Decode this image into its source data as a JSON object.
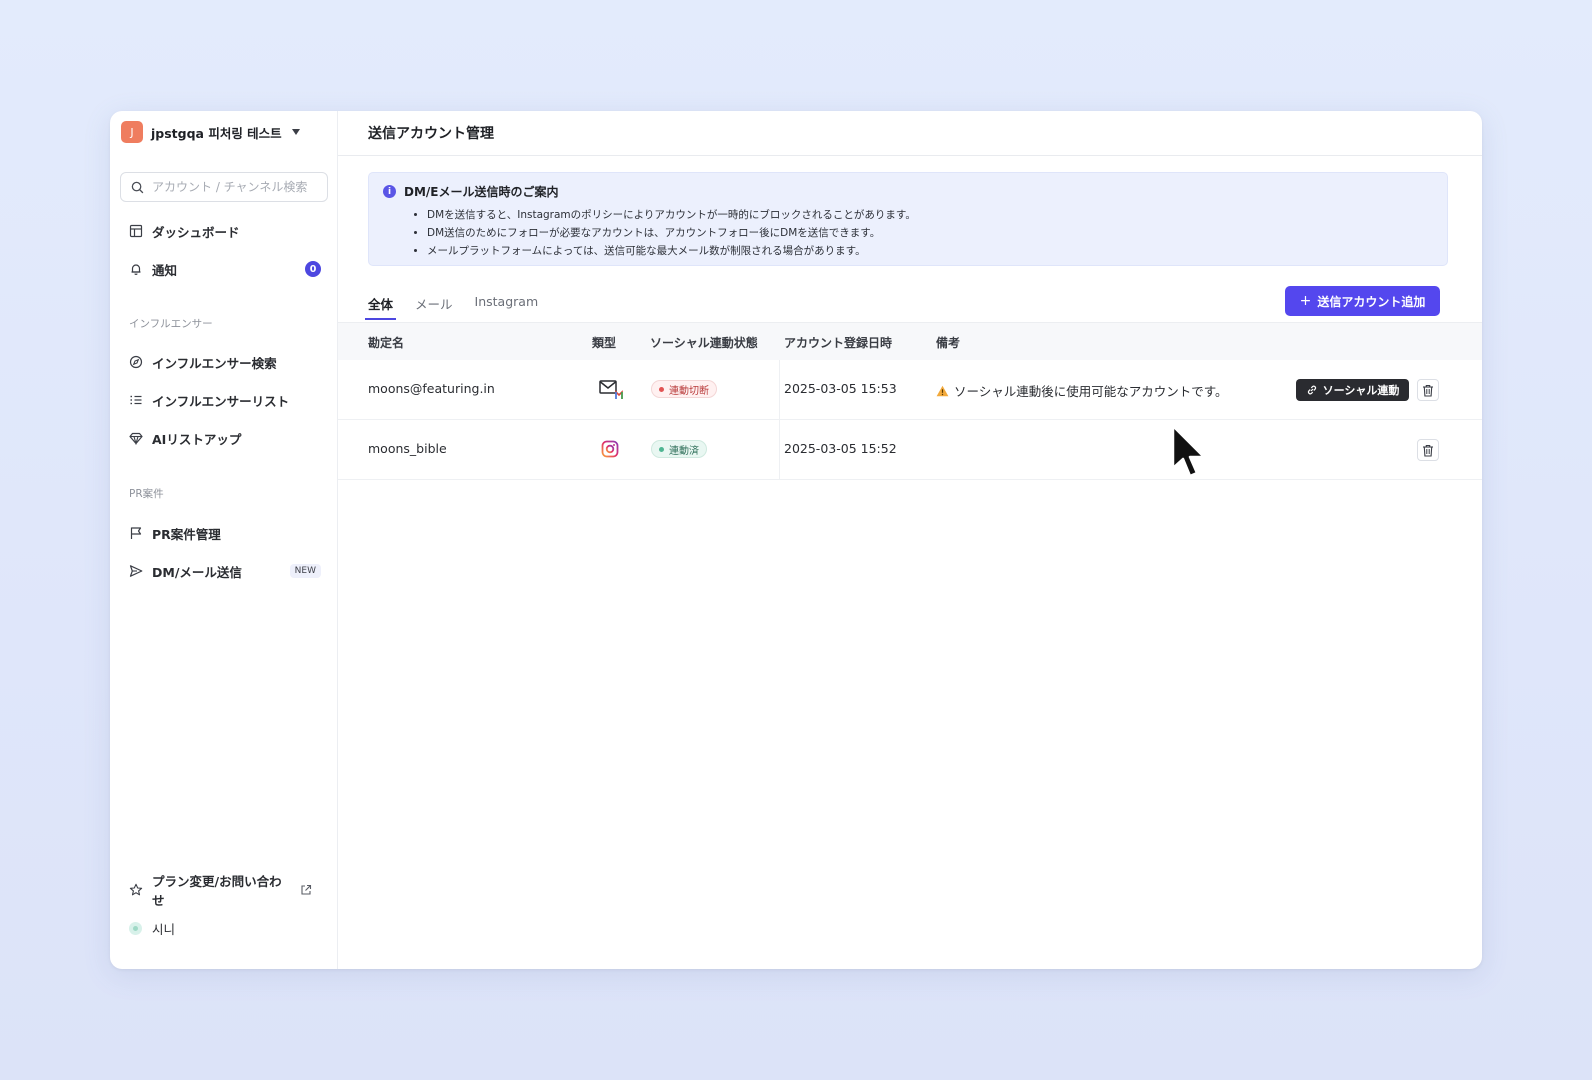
{
  "workspace": {
    "avatar_letter": "J",
    "name": "jpstgqa 피처링 테스트"
  },
  "sidebar": {
    "search_placeholder": "アカウント / チャンネル検索",
    "nav_top": [
      {
        "label": "ダッシュボード",
        "icon": "dashboard-icon"
      },
      {
        "label": "通知",
        "icon": "bell-icon",
        "badge": "0"
      }
    ],
    "section_influencer": "インフルエンサー",
    "nav_influencer": [
      {
        "label": "インフルエンサー検索",
        "icon": "compass-icon"
      },
      {
        "label": "インフルエンサーリスト",
        "icon": "list-icon"
      },
      {
        "label": "AIリストアップ",
        "icon": "diamond-icon"
      }
    ],
    "section_pr": "PR案件",
    "nav_pr": [
      {
        "label": "PR案件管理",
        "icon": "flag-icon"
      },
      {
        "label": "DM/メール送信",
        "icon": "send-icon",
        "tag": "NEW"
      }
    ],
    "plan_link": "プラン変更/お問い合わせ",
    "user_name": "시니"
  },
  "main": {
    "title": "送信アカウント管理",
    "notice": {
      "title": "DM/Eメール送信時のご案内",
      "items": [
        "DMを送信すると、Instagramのポリシーによりアカウントが一時的にブロックされることがあります。",
        "DM送信のためにフォローが必要なアカウントは、アカウントフォロー後にDMを送信できます。",
        "メールプラットフォームによっては、送信可能な最大メール数が制限される場合があります。"
      ]
    },
    "tabs": [
      "全体",
      "メール",
      "Instagram"
    ],
    "active_tab": "全体",
    "add_button": "送信アカウント追加",
    "table": {
      "headers": [
        "勘定名",
        "類型",
        "ソーシャル連動状態",
        "アカウント登録日時",
        "備考"
      ],
      "rows": [
        {
          "account": "moons@featuring.in",
          "type_icon": "gmail-icon",
          "status": "連動切断",
          "status_color": "#e25353",
          "registered": "2025-03-05 15:53",
          "note": "ソーシャル連動後に使用可能なアカウントです。",
          "action": "ソーシャル連動"
        },
        {
          "account": "moons_bible",
          "type_icon": "instagram-icon",
          "status": "連動済",
          "status_color": "#4fb592",
          "registered": "2025-03-05 15:52",
          "note": "",
          "action": ""
        }
      ]
    }
  },
  "colors": {
    "accent": "#5447ee",
    "badge": "#4d47e0",
    "workspace_avatar": "#ef7d5f"
  }
}
